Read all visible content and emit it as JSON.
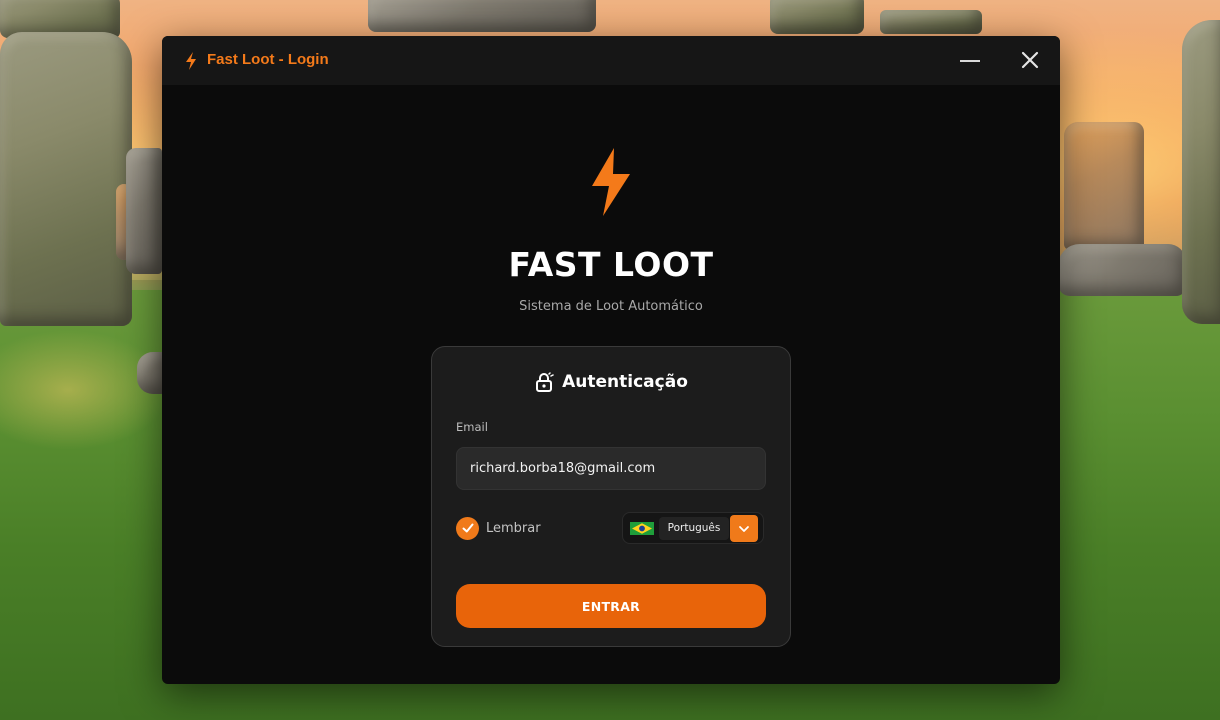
{
  "window": {
    "title": "Fast Loot - Login",
    "accent_color": "#f47a1a",
    "icon": "lightning-bolt-icon",
    "controls": {
      "minimize_icon": "minimize-icon",
      "close_icon": "close-icon"
    }
  },
  "hero": {
    "logo_icon": "lightning-bolt-icon",
    "app_name": "FAST LOOT",
    "tagline": "Sistema de Loot Automático"
  },
  "login_card": {
    "header_icon": "lock-icon",
    "title": "Autenticação",
    "email": {
      "label": "Email",
      "value": "richard.borba18@gmail.com"
    },
    "remember": {
      "label": "Lembrar",
      "checked": true
    },
    "language": {
      "flag_icon": "brazil-flag-icon",
      "selected": "Português",
      "dropdown_icon": "chevron-down-icon"
    },
    "submit_label": "ENTRAR",
    "button_color": "#e8640a"
  },
  "background": {
    "description_icon": "stonehenge-wallpaper"
  }
}
